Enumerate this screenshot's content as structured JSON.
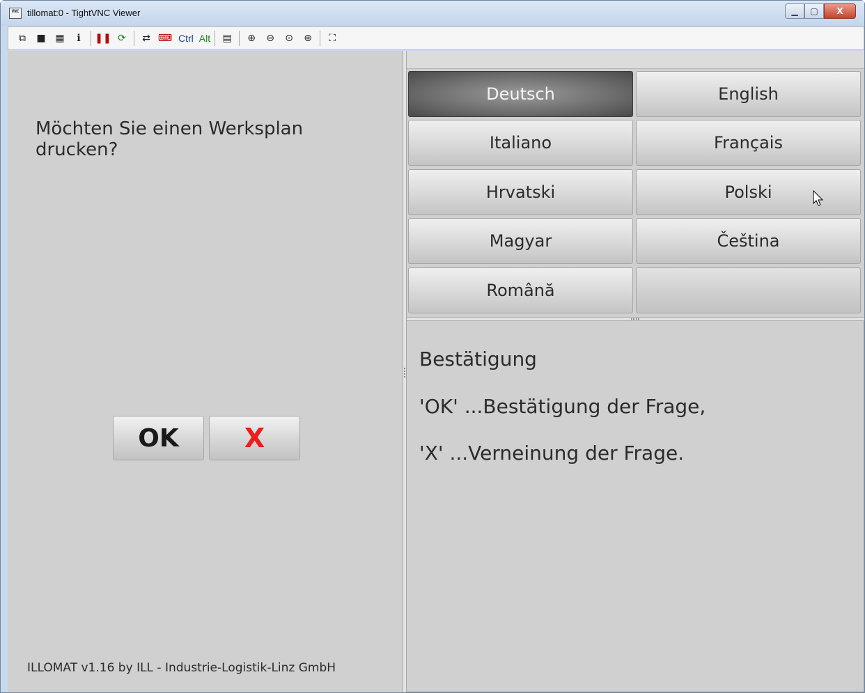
{
  "window": {
    "title": "tillomat:0 - TightVNC Viewer",
    "icon_text": "VNC",
    "controls": {
      "minimize": "▭",
      "maximize": "▢",
      "close": "X"
    }
  },
  "toolbar": {
    "ctrl_label": "Ctrl",
    "alt_label": "Alt",
    "icons": [
      "new-connection-icon",
      "save-icon",
      "options-icon",
      "info-icon",
      "pause-icon",
      "refresh-icon",
      "transfer-icon",
      "send-keys-icon",
      "ctrl-key-icon",
      "alt-key-icon",
      "clipboard-icon",
      "zoom-in-icon",
      "zoom-out-icon",
      "zoom-100-icon",
      "zoom-auto-icon",
      "fullscreen-icon"
    ]
  },
  "left": {
    "question": "Möchten Sie einen Werksplan drucken?",
    "ok_label": "OK",
    "cancel_label": "X",
    "footer": "ILLOMAT v1.16 by ILL - Industrie-Logistik-Linz GmbH"
  },
  "languages": [
    {
      "label": "Deutsch",
      "active": true
    },
    {
      "label": "English",
      "active": false
    },
    {
      "label": "Italiano",
      "active": false
    },
    {
      "label": "Français",
      "active": false
    },
    {
      "label": "Hrvatski",
      "active": false
    },
    {
      "label": "Polski",
      "active": false
    },
    {
      "label": "Magyar",
      "active": false
    },
    {
      "label": "Čeština",
      "active": false
    },
    {
      "label": "Română",
      "active": false
    },
    {
      "label": "",
      "active": false
    }
  ],
  "help": {
    "title": "Bestätigung",
    "line1": "'OK' ...Bestätigung der Frage,",
    "line2": "'X' ...Verneinung der Frage."
  },
  "colors": {
    "cancel_red": "#ee1c1c",
    "active_language": "#5c5c5c",
    "panel_gray": "#d0d0d0"
  }
}
